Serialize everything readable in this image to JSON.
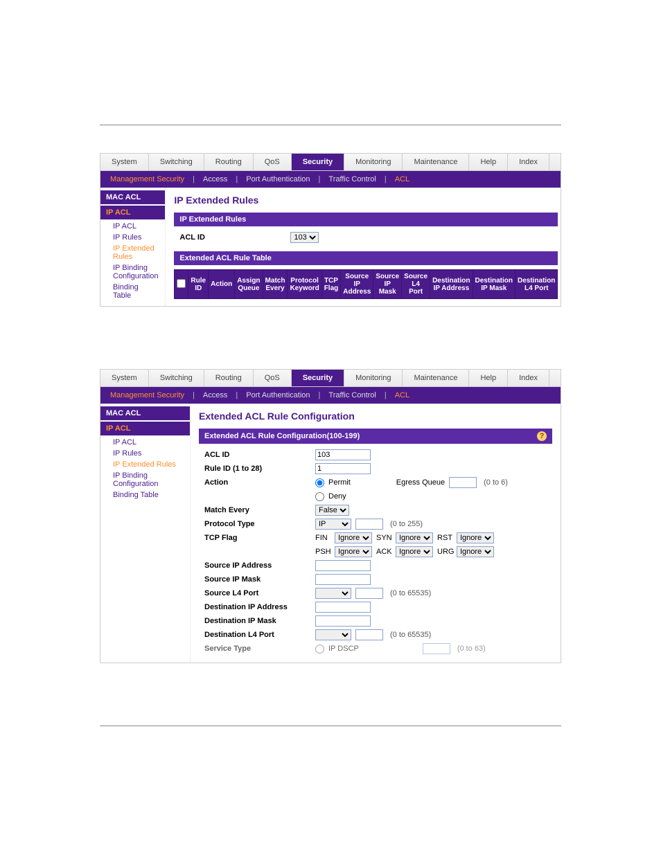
{
  "tabs": [
    "System",
    "Switching",
    "Routing",
    "QoS",
    "Security",
    "Monitoring",
    "Maintenance",
    "Help",
    "Index"
  ],
  "active_tab": "Security",
  "subtabs": {
    "mgmt": "Management Security",
    "access": "Access",
    "portauth": "Port Authentication",
    "traffic": "Traffic Control",
    "acl": "ACL"
  },
  "sidebar": {
    "mac_acl": "MAC ACL",
    "ip_acl": "IP ACL",
    "items": [
      "IP ACL",
      "IP Rules",
      "IP Extended Rules",
      "IP Binding Configuration",
      "Binding Table"
    ]
  },
  "panel1": {
    "title": "IP Extended Rules",
    "section1": "IP Extended Rules",
    "acl_id_label": "ACL ID",
    "acl_id_value": "103",
    "section2": "Extended ACL Rule Table",
    "cols": [
      "Rule ID",
      "Action",
      "Assign Queue",
      "Match Every",
      "Protocol Keyword",
      "TCP Flag",
      "Source IP Address",
      "Source IP Mask",
      "Source L4 Port",
      "Destination IP Address",
      "Destination IP Mask",
      "Destination L4 Port"
    ]
  },
  "panel2": {
    "title": "Extended ACL Rule Configuration",
    "section": "Extended ACL Rule Configuration(100-199)",
    "fields": {
      "acl_id": {
        "label": "ACL ID",
        "value": "103"
      },
      "rule_id": {
        "label": "Rule ID (1 to 28)",
        "value": "1"
      },
      "action": {
        "label": "Action",
        "permit": "Permit",
        "deny": "Deny",
        "egress_lbl": "Egress Queue",
        "egress_hint": "(0 to 6)"
      },
      "match_every": {
        "label": "Match Every",
        "value": "False"
      },
      "proto": {
        "label": "Protocol Type",
        "value": "IP",
        "hint": "(0 to 255)"
      },
      "tcp": {
        "label": "TCP Flag",
        "fin": "FIN",
        "syn": "SYN",
        "rst": "RST",
        "psh": "PSH",
        "ack": "ACK",
        "urg": "URG",
        "ignore": "Ignore"
      },
      "src_ip": "Source IP Address",
      "src_mask": "Source IP Mask",
      "src_l4": {
        "label": "Source L4 Port",
        "hint": "(0 to 65535)"
      },
      "dst_ip": "Destination IP Address",
      "dst_mask": "Destination IP Mask",
      "dst_l4": {
        "label": "Destination L4 Port",
        "hint": "(0 to 65535)"
      },
      "svc": {
        "label": "Service Type",
        "dscp": "IP DSCP",
        "hint": "(0 to 63)"
      }
    }
  }
}
